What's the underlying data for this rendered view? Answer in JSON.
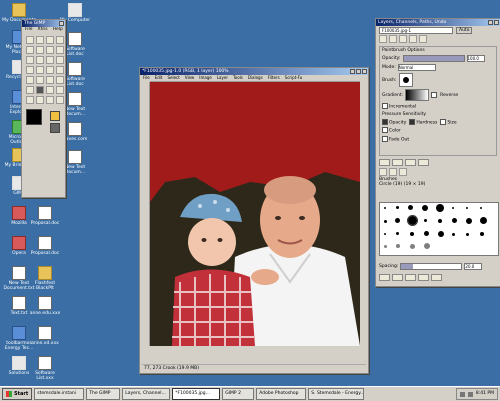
{
  "desktop_icons": [
    {
      "label": "My Documents"
    },
    {
      "label": "My Network Places"
    },
    {
      "label": "Recycle Bin"
    },
    {
      "label": "Internet Explorer"
    },
    {
      "label": "Microsoft Outlook"
    },
    {
      "label": "My Briefcase"
    },
    {
      "label": "GIMP"
    },
    {
      "label": "Mozilla"
    },
    {
      "label": "Opera"
    },
    {
      "label": "New Text Document.txt"
    },
    {
      "label": "Text.txt"
    },
    {
      "label": "toolbarmos Energy Tec..."
    },
    {
      "label": "Solutions"
    },
    {
      "label": "My Computer"
    },
    {
      "label": "Software List.doc"
    },
    {
      "label": "Software List.doc"
    },
    {
      "label": "New Text Docum..."
    },
    {
      "label": "Caves.com"
    },
    {
      "label": "New Text Docum..."
    },
    {
      "label": "Proposal.doc"
    },
    {
      "label": "Proposal.doc"
    },
    {
      "label": "Flashfest BlackPlt"
    },
    {
      "label": "anne.edu.xxx"
    },
    {
      "label": "anne.xd.xxx"
    },
    {
      "label": "Software List.xxx"
    }
  ],
  "toolbox": {
    "title": "The GIMP",
    "menu": [
      "File",
      "Xtns",
      "Help"
    ]
  },
  "image_window": {
    "title": "*F100035.jpg-1.0 (RGB, 1 layer) 100%",
    "menu": [
      "File",
      "Edit",
      "Select",
      "View",
      "Image",
      "Layer",
      "Tools",
      "Dialogs",
      "Filters",
      "Script-Fu"
    ],
    "status": "77, 273   Crook (19.9 MB)"
  },
  "layers_dialog": {
    "title": "Layers, Channels, Paths, Undo",
    "image_label": "F100035.jpg-1",
    "auto_label": "Auto",
    "paint_options_title": "Paintbrush Options",
    "opacity_label": "Opacity:",
    "opacity_value": "100.0",
    "mode_label": "Mode:",
    "mode_value": "Normal",
    "brush_label": "Brush:",
    "gradient_label": "Gradient:",
    "reverse_label": "Reverse",
    "incremental_label": "Incremental",
    "pressure_label": "Pressure Sensitivity",
    "opacity_chk": "Opacity",
    "hardness_chk": "Hardness",
    "size_chk": "Size",
    "color_chk": "Color",
    "fade_label": "Fade Out",
    "brushes_title": "Brushes",
    "brush_name": "Circle (19) (19 × 19)",
    "spacing_label": "Spacing:",
    "spacing_value": "20.0"
  },
  "taskbar": {
    "start": "Start",
    "tasks": [
      "stemsdale.irstani",
      "The GIMP",
      "Layers, Channel...",
      "*F100035.jpg...",
      "GIMP 2",
      "Adobe Photoshop",
      "S. Stemsdale - Energy..."
    ],
    "active_index": 3,
    "time": "8:41 PM"
  }
}
